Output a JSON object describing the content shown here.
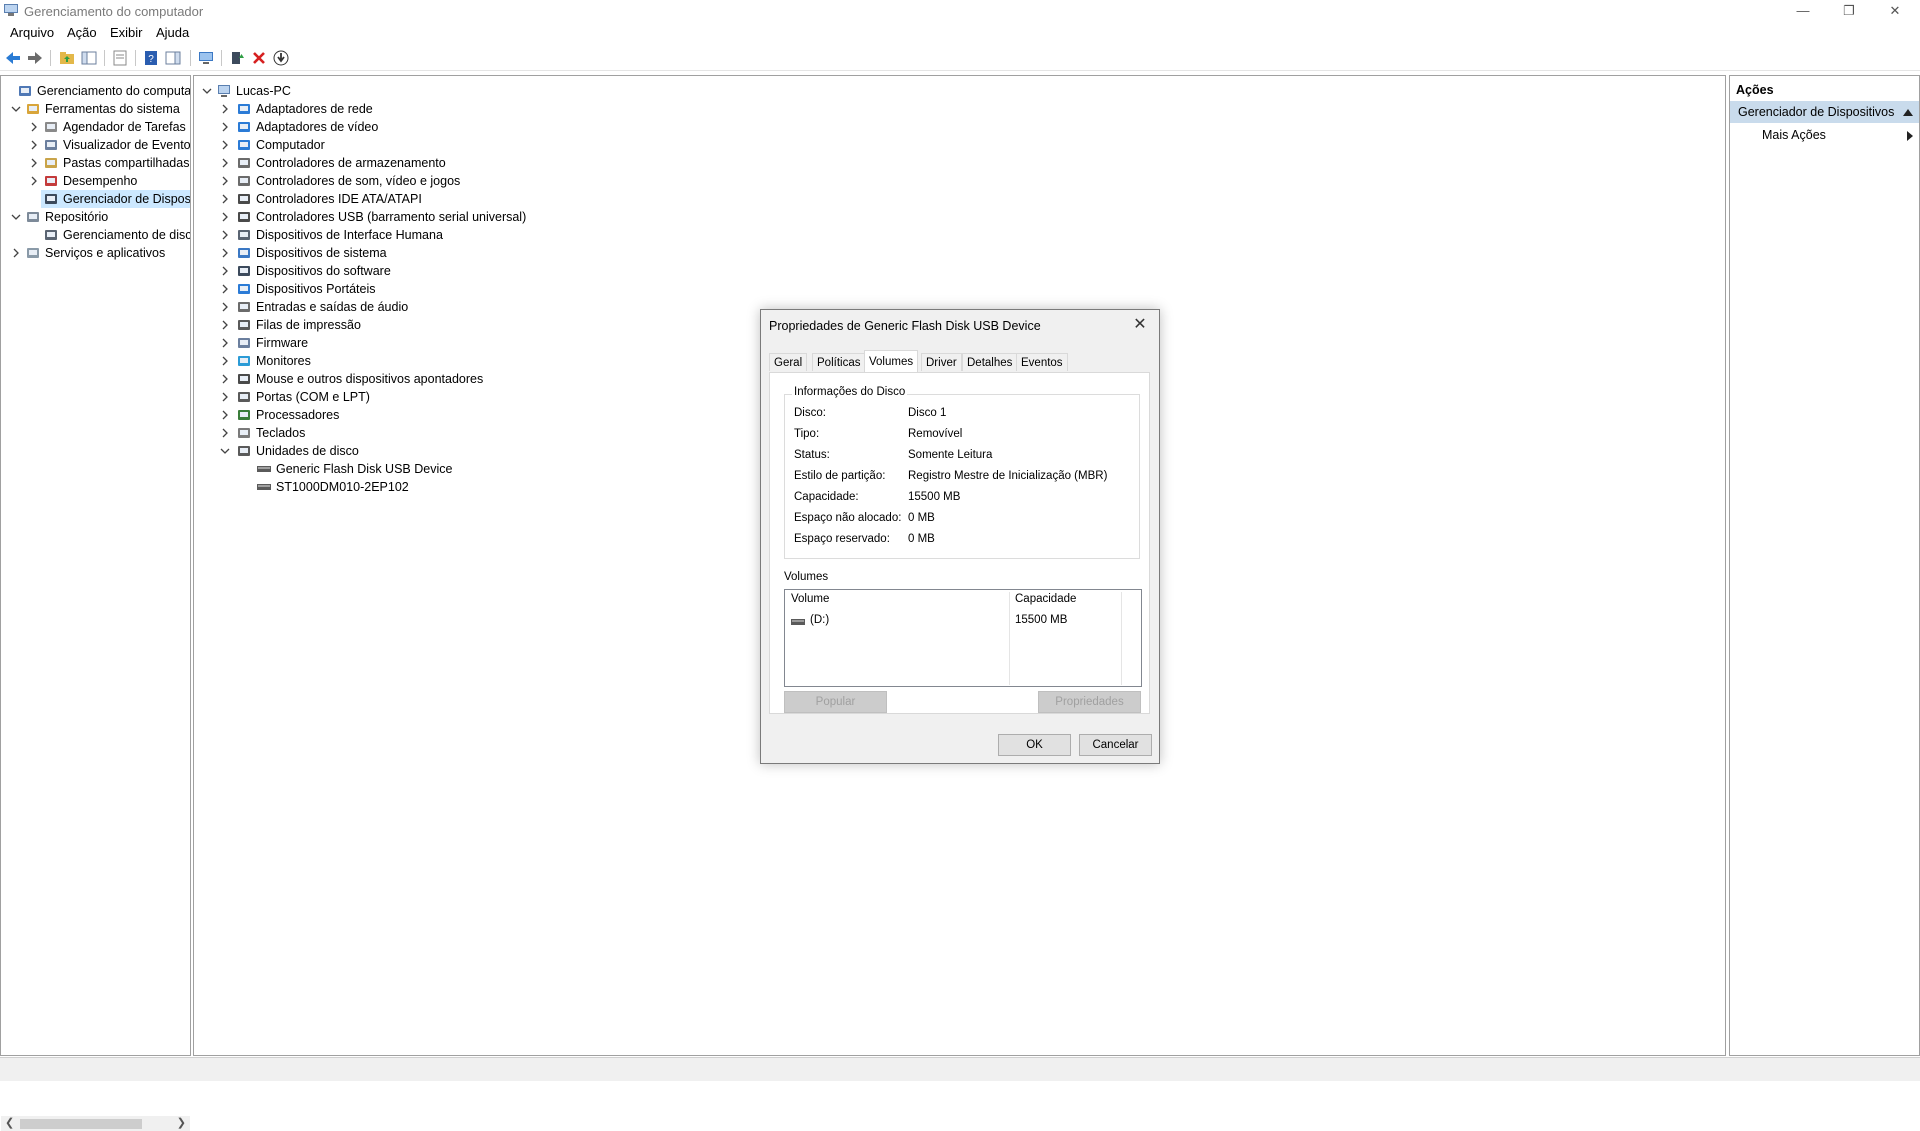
{
  "window": {
    "title": "Gerenciamento do computador",
    "controls": [
      "—",
      "❐",
      "✕"
    ]
  },
  "menu": [
    "Arquivo",
    "Ação",
    "Exibir",
    "Ajuda"
  ],
  "left_tree": [
    {
      "label": "Gerenciamento do computador (Local)",
      "icon": "computer-management-icon",
      "indent": 0,
      "twisty": ""
    },
    {
      "label": "Ferramentas do sistema",
      "icon": "tools-icon",
      "indent": 1,
      "twisty": "expanded"
    },
    {
      "label": "Agendador de Tarefas",
      "icon": "clock-icon",
      "indent": 2,
      "twisty": "collapsed"
    },
    {
      "label": "Visualizador de Eventos",
      "icon": "event-viewer-icon",
      "indent": 2,
      "twisty": "collapsed"
    },
    {
      "label": "Pastas compartilhadas",
      "icon": "shared-folder-icon",
      "indent": 2,
      "twisty": "collapsed"
    },
    {
      "label": "Desempenho",
      "icon": "performance-icon",
      "indent": 2,
      "twisty": "collapsed"
    },
    {
      "label": "Gerenciador de Dispositivos",
      "icon": "device-manager-icon",
      "indent": 2,
      "twisty": "",
      "selected": true
    },
    {
      "label": "Repositório",
      "icon": "storage-icon",
      "indent": 1,
      "twisty": "expanded"
    },
    {
      "label": "Gerenciamento de disco",
      "icon": "disk-management-icon",
      "indent": 2,
      "twisty": ""
    },
    {
      "label": "Serviços e aplicativos",
      "icon": "services-icon",
      "indent": 1,
      "twisty": "collapsed"
    }
  ],
  "device_tree": {
    "root": "Lucas-PC",
    "categories": [
      {
        "label": "Adaptadores de rede",
        "icon": "network-adapter-icon"
      },
      {
        "label": "Adaptadores de vídeo",
        "icon": "display-adapter-icon"
      },
      {
        "label": "Computador",
        "icon": "computer-icon"
      },
      {
        "label": "Controladores de armazenamento",
        "icon": "storage-controller-icon"
      },
      {
        "label": "Controladores de som, vídeo e jogos",
        "icon": "sound-icon"
      },
      {
        "label": "Controladores IDE ATA/ATAPI",
        "icon": "ide-icon"
      },
      {
        "label": "Controladores USB (barramento serial universal)",
        "icon": "usb-icon"
      },
      {
        "label": "Dispositivos de Interface Humana",
        "icon": "hid-icon"
      },
      {
        "label": "Dispositivos de sistema",
        "icon": "system-device-icon"
      },
      {
        "label": "Dispositivos do software",
        "icon": "software-device-icon"
      },
      {
        "label": "Dispositivos Portáteis",
        "icon": "portable-device-icon"
      },
      {
        "label": "Entradas e saídas de áudio",
        "icon": "audio-icon"
      },
      {
        "label": "Filas de impressão",
        "icon": "printer-icon"
      },
      {
        "label": "Firmware",
        "icon": "firmware-icon"
      },
      {
        "label": "Monitores",
        "icon": "monitor-icon"
      },
      {
        "label": "Mouse e outros dispositivos apontadores",
        "icon": "mouse-icon"
      },
      {
        "label": "Portas (COM e LPT)",
        "icon": "port-icon"
      },
      {
        "label": "Processadores",
        "icon": "processor-icon"
      },
      {
        "label": "Teclados",
        "icon": "keyboard-icon"
      },
      {
        "label": "Unidades de disco",
        "icon": "disk-drive-icon",
        "expanded": true
      }
    ],
    "disk_children": [
      "Generic Flash Disk USB Device",
      "ST1000DM010-2EP102"
    ]
  },
  "actions": {
    "header": "Ações",
    "group": "Gerenciador de Dispositivos",
    "item": "Mais Ações"
  },
  "dialog": {
    "title": "Propriedades de Generic Flash Disk USB Device",
    "tabs": [
      "Geral",
      "Políticas",
      "Volumes",
      "Driver",
      "Detalhes",
      "Eventos"
    ],
    "active_tab": "Volumes",
    "group_title": "Informações do Disco",
    "info": [
      {
        "label": "Disco:",
        "value": "Disco 1"
      },
      {
        "label": "Tipo:",
        "value": "Removível"
      },
      {
        "label": "Status:",
        "value": "Somente Leitura"
      },
      {
        "label": "Estilo de partição:",
        "value": "Registro Mestre de Inicialização (MBR)"
      },
      {
        "label": "Capacidade:",
        "value": "15500 MB"
      },
      {
        "label": "Espaço não alocado:",
        "value": "0 MB"
      },
      {
        "label": "Espaço reservado:",
        "value": "0 MB"
      }
    ],
    "volumes_label": "Volumes",
    "volume_columns": [
      "Volume",
      "Capacidade"
    ],
    "volumes": [
      {
        "volume": "(D:)",
        "capacity": "15500 MB"
      }
    ],
    "btn_populate": "Popular",
    "btn_properties": "Propriedades",
    "btn_ok": "OK",
    "btn_cancel": "Cancelar"
  }
}
